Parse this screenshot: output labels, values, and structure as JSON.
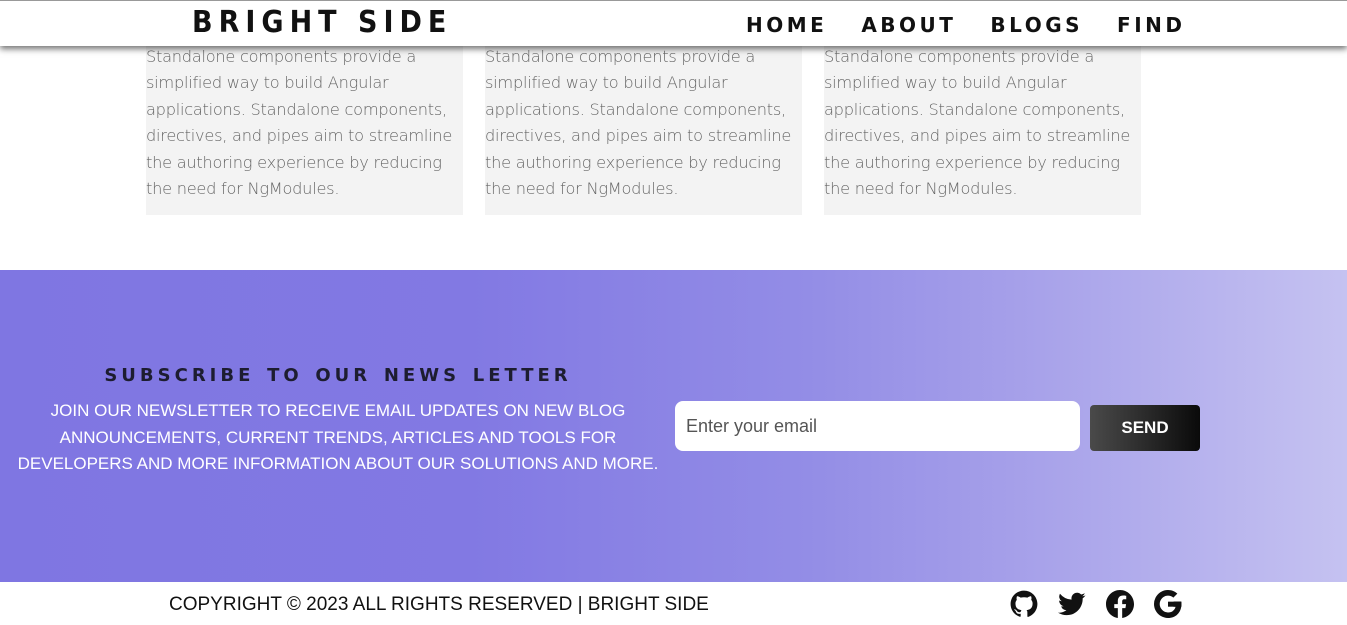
{
  "header": {
    "logo": "BRIGHT SIDE",
    "nav": [
      "HOME",
      "ABOUT",
      "BLOGS",
      "FIND"
    ]
  },
  "cards": [
    {
      "text": "Standalone components provide a simplified way to build Angular applications. Standalone components, directives, and pipes aim to streamline the authoring experience by reducing the need for NgModules."
    },
    {
      "text": "Standalone components provide a simplified way to build Angular applications. Standalone components, directives, and pipes aim to streamline the authoring experience by reducing the need for NgModules."
    },
    {
      "text": "Standalone components provide a simplified way to build Angular applications. Standalone components, directives, and pipes aim to streamline the authoring experience by reducing the need for NgModules."
    }
  ],
  "newsletter": {
    "title": "Subscribe to our News Letter",
    "description": "JOIN OUR NEWSLETTER TO RECEIVE EMAIL UPDATES ON NEW BLOG ANNOUNCEMENTS, CURRENT TRENDS, ARTICLES AND TOOLS FOR DEVELOPERS AND MORE INFORMATION ABOUT OUR SOLUTIONS AND MORE.",
    "email_placeholder": "Enter your email",
    "email_value": "",
    "send_label": "SEND"
  },
  "footer": {
    "copyright": "COPYRIGHT © 2023 ALL RIGHTS RESERVED | BRIGHT SIDE",
    "socials": [
      "github-icon",
      "twitter-icon",
      "facebook-icon",
      "google-icon"
    ]
  },
  "colors": {
    "band_start": "#7f76e2",
    "band_end": "#c5c2f1",
    "card_bg": "#f3f3f3",
    "button_dark": "#0a0a0a"
  }
}
